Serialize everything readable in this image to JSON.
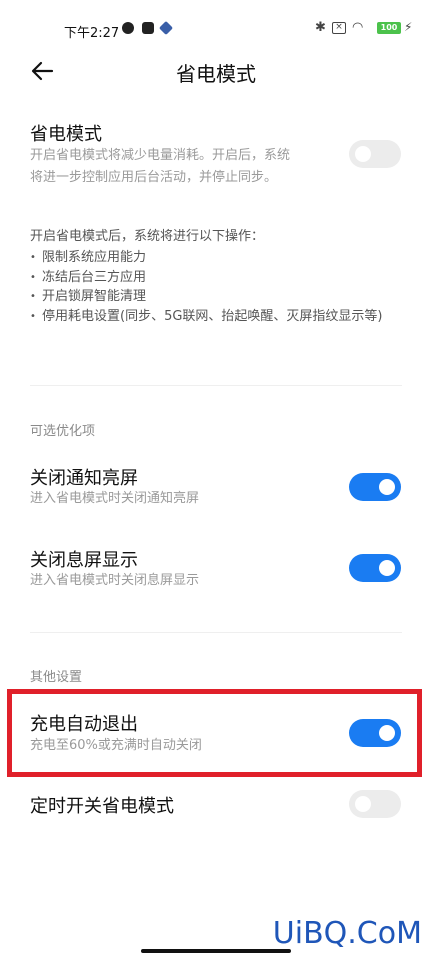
{
  "status_bar": {
    "time": "下午2:27",
    "battery": "100",
    "icons": [
      "app-icon",
      "app-icon",
      "app-icon",
      "bluetooth-icon",
      "sim-off-icon",
      "wifi-icon",
      "battery-icon",
      "charging-icon"
    ]
  },
  "header": {
    "title": "省电模式",
    "back_icon": "back-arrow-icon"
  },
  "power_saving": {
    "title": "省电模式",
    "subtitle_line1": "开启省电模式将减少电量消耗。开启后，系统",
    "subtitle_line2": "将进一步控制应用后台活动，并停止同步。",
    "enabled": false
  },
  "info": {
    "intro": "开启省电模式后，系统将进行以下操作：",
    "items": [
      "限制系统应用能力",
      "冻结后台三方应用",
      "开启锁屏智能清理",
      "停用耗电设置(同步、5G联网、抬起唤醒、灭屏指纹显示等)"
    ]
  },
  "optional_section": {
    "label": "可选优化项",
    "items": [
      {
        "title": "关闭通知亮屏",
        "subtitle": "进入省电模式时关闭通知亮屏",
        "enabled": true
      },
      {
        "title": "关闭息屏显示",
        "subtitle": "进入省电模式时关闭息屏显示",
        "enabled": true
      }
    ]
  },
  "other_section": {
    "label": "其他设置",
    "items": [
      {
        "title": "充电自动退出",
        "subtitle": "充电至60%或充满时自动关闭",
        "enabled": true,
        "highlighted": true
      },
      {
        "title": "定时开关省电模式",
        "enabled": false
      }
    ]
  },
  "watermark": "UiBQ.CoM",
  "colors": {
    "toggle_on": "#1a7cf2",
    "toggle_off": "#ececec",
    "highlight": "#e0202a",
    "watermark": "#1f56b8"
  }
}
